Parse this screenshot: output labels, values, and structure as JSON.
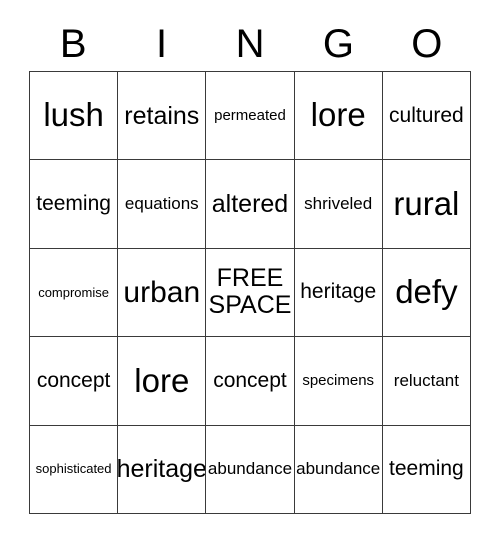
{
  "card": {
    "title_letters": [
      "B",
      "I",
      "N",
      "G",
      "O"
    ],
    "free_space_label": "FREE SPACE",
    "colors": {
      "background": "#ffffff",
      "text": "#000000",
      "grid_line": "#3a3a3a"
    },
    "grid": {
      "columns": 5,
      "rows": 5,
      "cells": [
        [
          {
            "text": "lush",
            "size": "xxl"
          },
          {
            "text": "retains",
            "size": "lg"
          },
          {
            "text": "permeated",
            "size": "xs"
          },
          {
            "text": "lore",
            "size": "xxl"
          },
          {
            "text": "cultured",
            "size": "md"
          }
        ],
        [
          {
            "text": "teeming",
            "size": "md"
          },
          {
            "text": "equations",
            "size": "sm"
          },
          {
            "text": "altered",
            "size": "lg"
          },
          {
            "text": "shriveled",
            "size": "sm"
          },
          {
            "text": "rural",
            "size": "xxl"
          }
        ],
        [
          {
            "text": "compromise",
            "size": "xxs"
          },
          {
            "text": "urban",
            "size": "xl"
          },
          {
            "text": "FREE SPACE",
            "size": "free"
          },
          {
            "text": "heritage",
            "size": "md"
          },
          {
            "text": "defy",
            "size": "xxl"
          }
        ],
        [
          {
            "text": "concept",
            "size": "md"
          },
          {
            "text": "lore",
            "size": "xxl"
          },
          {
            "text": "concept",
            "size": "md"
          },
          {
            "text": "specimens",
            "size": "xs"
          },
          {
            "text": "reluctant",
            "size": "sm"
          }
        ],
        [
          {
            "text": "sophisticated",
            "size": "xxs"
          },
          {
            "text": "heritage",
            "size": "lg"
          },
          {
            "text": "abundance",
            "size": "sm"
          },
          {
            "text": "abundance",
            "size": "sm"
          },
          {
            "text": "teeming",
            "size": "md"
          }
        ]
      ]
    }
  }
}
